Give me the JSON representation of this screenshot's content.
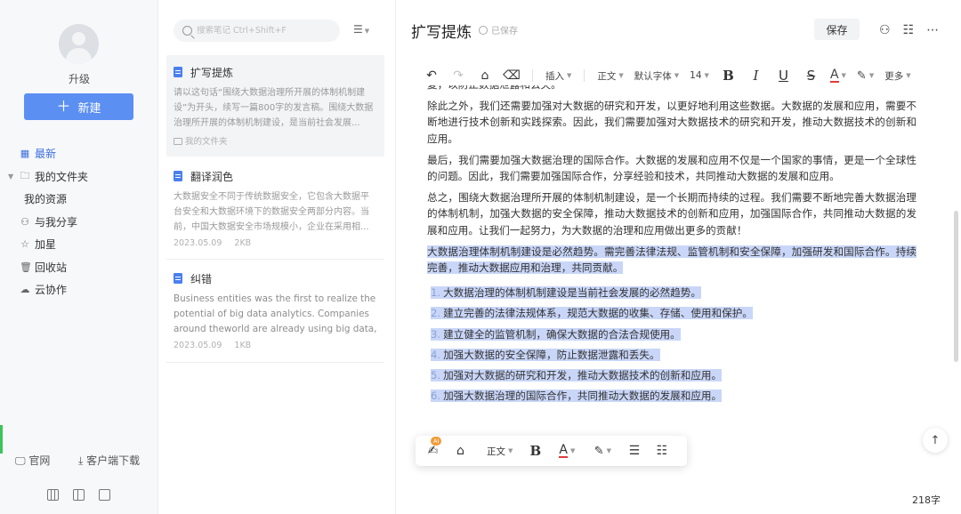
{
  "sidebar": {
    "upgrade_label": "升级",
    "new_button": "新建",
    "nav": [
      {
        "label": "最新",
        "icon": "grid-icon"
      },
      {
        "label": "我的文件夹",
        "icon": "folder-icon"
      },
      {
        "label": "我的资源",
        "icon": ""
      },
      {
        "label": "与我分享",
        "icon": "user-share-icon"
      },
      {
        "label": "加星",
        "icon": "star-icon"
      },
      {
        "label": "回收站",
        "icon": "trash-icon"
      },
      {
        "label": "云协作",
        "icon": "cloud-icon"
      }
    ],
    "official_site": "官网",
    "client_download": "客户端下载"
  },
  "notes": {
    "search_placeholder": "搜索笔记 Ctrl+Shift+F",
    "items": [
      {
        "title": "扩写提炼",
        "snippet": "请以这句话“围绕大数据治理所开展的体制机制建设”为开头，续写一篇800字的发言稿。围绕大数据治理所开展的体制机制建设，是当前社会发展...",
        "folder": "我的文件夹",
        "date": "",
        "size": ""
      },
      {
        "title": "翻译润色",
        "snippet": "大数据安全不同于传统数据安全，它包含大数据平台安全和大数据环境下的数据安全两部分内容。当前，中国大数据安全市场规模小，企业在采用相...",
        "folder": "",
        "date": "2023.05.09",
        "size": "2KB"
      },
      {
        "title": "纠错",
        "snippet": "Business entities was the first to realize the potential of big data analytics. Companies around theworld are already using big data, s...",
        "folder": "",
        "date": "2023.05.09",
        "size": "1KB"
      }
    ]
  },
  "editor": {
    "title": "扩写提炼",
    "saved_status": "已保存",
    "save_button": "保存",
    "toolbar": {
      "insert": "插入",
      "paragraph_style": "正文",
      "font": "默认字体",
      "font_size": "14",
      "more": "更多"
    },
    "content": {
      "top_fragment": "复，以防止数据泄露和丢失。",
      "paragraphs": [
        "除此之外，我们还需要加强对大数据的研究和开发，以更好地利用这些数据。大数据的发展和应用，需要不断地进行技术创新和实践探索。因此，我们需要加强对大数据技术的研究和开发，推动大数据技术的创新和应用。",
        "最后，我们需要加强大数据治理的国际合作。大数据的发展和应用不仅是一个国家的事情，更是一个全球性的问题。因此，我们需要加强国际合作，分享经验和技术，共同推动大数据的发展和应用。",
        "总之，围绕大数据治理所开展的体制机制建设，是一个长期而持续的过程。我们需要不断地完善大数据治理的体制机制，加强大数据的安全保障，推动大数据技术的创新和应用，加强国际合作，共同推动大数据的发展和应用。让我们一起努力，为大数据的治理和应用做出更多的贡献！"
      ],
      "highlighted_paragraph": "大数据治理体制机制建设是必然趋势。需完善法律法规、监管机制和安全保障，加强研发和国际合作。持续完善，推动大数据应用和治理，共同贡献。",
      "list": [
        "大数据治理的体制机制建设是当前社会发展的必然趋势。",
        "建立完善的法律法规体系，规范大数据的收集、存储、使用和保护。",
        "建立健全的监管机制，确保大数据的合法合规使用。",
        "加强大数据的安全保障，防止数据泄露和丢失。",
        "加强对大数据的研究和开发，推动大数据技术的创新和应用。",
        "加强大数据治理的国际合作，共同推动大数据的发展和应用。"
      ]
    },
    "floating_toolbar": {
      "ai_badge": "AI",
      "paragraph_style": "正文"
    },
    "word_count": "218字"
  },
  "colors": {
    "accent": "#5b8ff2",
    "highlight": "#c9d6f8",
    "ai_badge": "#f29b38"
  }
}
